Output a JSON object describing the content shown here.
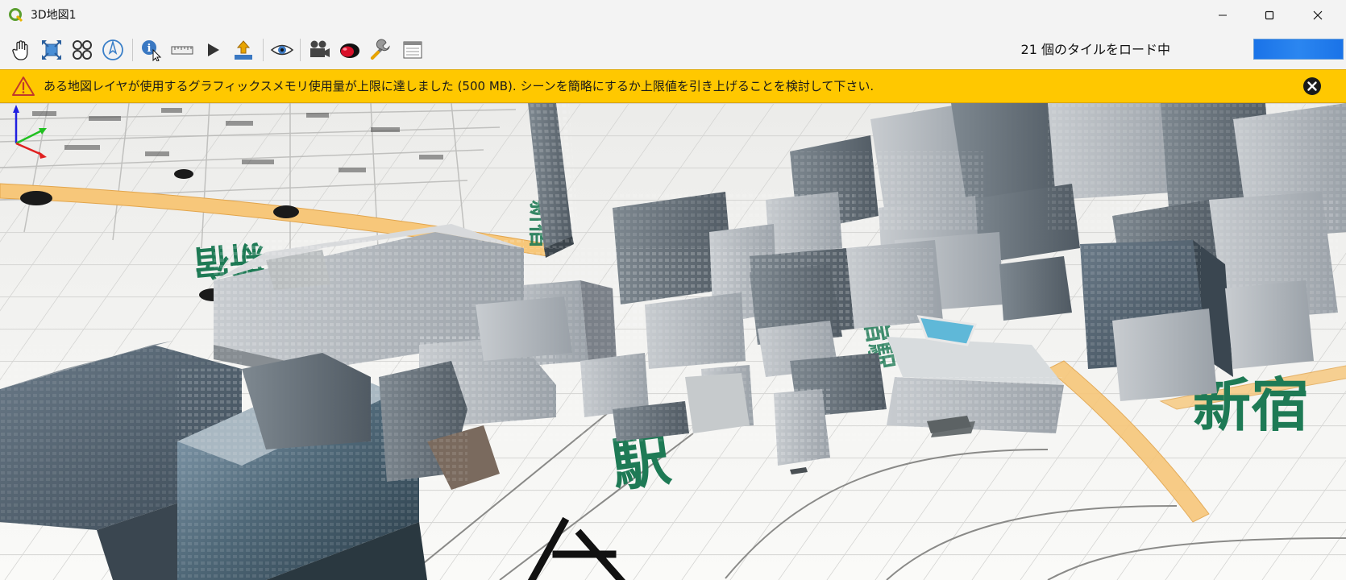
{
  "window": {
    "title": "3D地図1",
    "app_icon": "qgis-logo-icon",
    "controls": {
      "minimize": "minimize-icon",
      "maximize": "maximize-icon",
      "close": "close-icon"
    }
  },
  "toolbar": {
    "tools": [
      {
        "name": "pan-tool",
        "icon": "hand-icon"
      },
      {
        "name": "zoom-full",
        "icon": "zoom-full-icon"
      },
      {
        "name": "camera-control",
        "icon": "camera-orbit-icon"
      },
      {
        "name": "north",
        "icon": "north-arrow-icon"
      },
      {
        "name": "identify",
        "icon": "identify-icon"
      },
      {
        "name": "measure",
        "icon": "ruler-icon"
      },
      {
        "name": "animation",
        "icon": "play-icon"
      },
      {
        "name": "export",
        "icon": "export-icon"
      },
      {
        "name": "view-options",
        "icon": "eye-icon"
      },
      {
        "name": "camera",
        "icon": "video-camera-icon"
      },
      {
        "name": "effects",
        "icon": "effects-icon"
      },
      {
        "name": "configure",
        "icon": "wrench-icon"
      },
      {
        "name": "dock",
        "icon": "window-icon"
      }
    ],
    "tile_status": "21 個のタイルをロード中",
    "progress": 1.0,
    "accent": "#1a73e8"
  },
  "warning": {
    "text": "ある地図レイヤが使用するグラフィックスメモリ使用量が上限に達しました (500 MB). シーンを簡略にするか上限値を引き上げることを検討して下さい.",
    "icon": "warning-triangle-icon",
    "close_icon": "close-circle-icon",
    "color": "#ffc800"
  },
  "scene": {
    "map_labels": [
      "新宿",
      "駅",
      "新宿駅"
    ],
    "axes": {
      "x_color": "#e02020",
      "y_color": "#20c020",
      "z_color": "#2020e0"
    }
  }
}
